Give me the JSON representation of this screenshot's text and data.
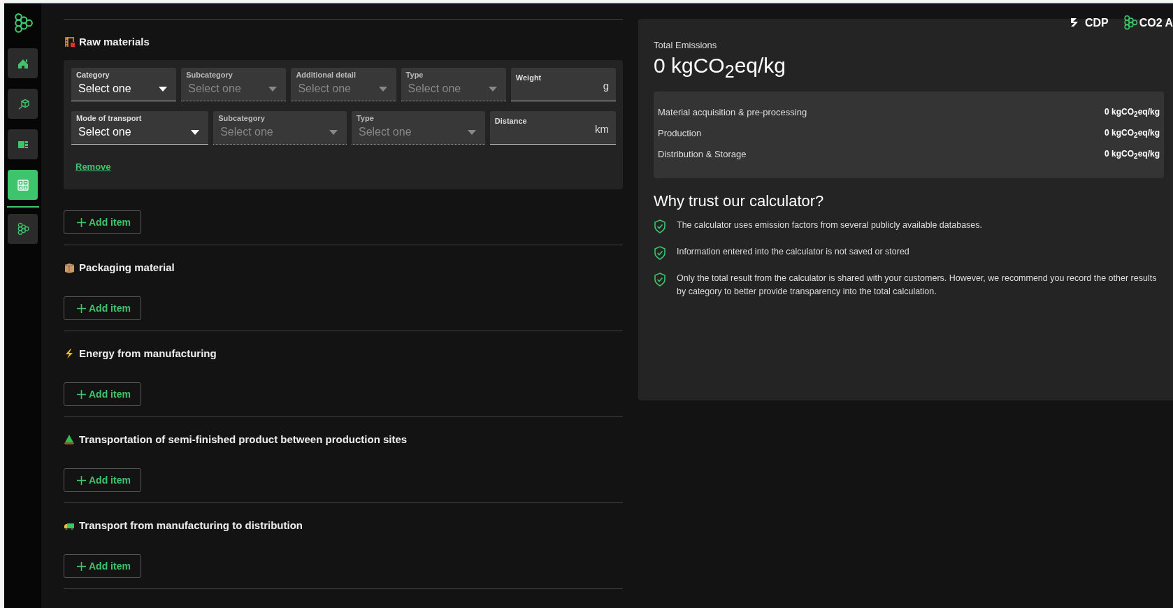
{
  "sidebar": {
    "items": [
      {
        "selected": false
      },
      {
        "selected": false
      },
      {
        "selected": false
      },
      {
        "selected": true
      },
      {
        "selected": false
      }
    ]
  },
  "sections": [
    {
      "title": "Raw materials",
      "items": [
        {
          "field_groups": [
            {
              "fields": [
                {
                  "kind": "select",
                  "label": "Category",
                  "placeholder": "Select one",
                  "disabled": false
                },
                {
                  "kind": "select",
                  "label": "Subcategory",
                  "placeholder": "Select one",
                  "disabled": true
                },
                {
                  "kind": "select",
                  "label": "Additional detail",
                  "placeholder": "Select one",
                  "disabled": true
                },
                {
                  "kind": "select",
                  "label": "Type",
                  "placeholder": "Select one",
                  "disabled": true
                },
                {
                  "kind": "number",
                  "label": "Weight",
                  "unit": "g"
                }
              ]
            },
            {
              "fields": [
                {
                  "kind": "select",
                  "label": "Mode of transport",
                  "placeholder": "Select one",
                  "disabled": false
                },
                {
                  "kind": "select",
                  "label": "Subcategory",
                  "placeholder": "Select one",
                  "disabled": true
                },
                {
                  "kind": "select",
                  "label": "Type",
                  "placeholder": "Select one",
                  "disabled": true
                },
                {
                  "kind": "number",
                  "label": "Distance",
                  "unit": "km"
                }
              ]
            }
          ],
          "remove": "Remove"
        }
      ],
      "add": "Add item"
    },
    {
      "title": "Packaging material",
      "add": "Add item"
    },
    {
      "title": "Energy from manufacturing",
      "add": "Add item"
    },
    {
      "title": "Transportation of semi-finished product between production sites",
      "add": "Add item"
    },
    {
      "title": "Transport from manufacturing to distribution",
      "add": "Add item"
    }
  ],
  "results": {
    "logos": [
      "CDP",
      "CO2 A"
    ],
    "total_label": "Total Emissions",
    "total_value": "0 kgCO$_{2}$eq/kg",
    "breakdown": [
      {
        "label": "Material acquisition & pre-processing",
        "value": "0 kgCO$_{2}$eq/kg"
      },
      {
        "label": "Production",
        "value": "0 kgCO$_{2}$eq/kg"
      },
      {
        "label": "Distribution & Storage",
        "value": "0 kgCO$_{2}$eq/kg"
      }
    ],
    "trust_title": "Why trust our calculator?",
    "trust_points": [
      "The calculator uses emission factors from several publicly available databases.",
      "Information entered into the calculator is not saved or stored",
      "Only the total result from the calculator is shared with your customers. However, we recommend you record the other results by category to better provide transparency into the total calculation."
    ]
  }
}
